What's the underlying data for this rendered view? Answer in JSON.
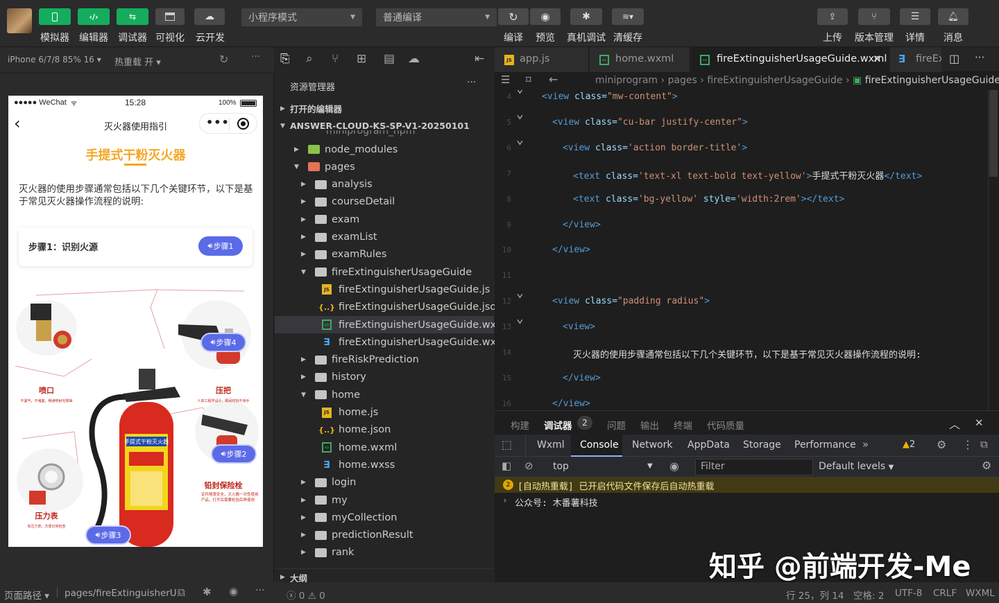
{
  "toolbar": {
    "left_buttons": [
      {
        "label": "模拟器",
        "icon": "phone-icon"
      },
      {
        "label": "编辑器",
        "icon": "code-icon"
      },
      {
        "label": "调试器",
        "icon": "debug-icon"
      },
      {
        "label": "可视化",
        "icon": "layout-icon"
      },
      {
        "label": "云开发",
        "icon": "cloud-icon"
      }
    ],
    "mode_select": "小程序模式",
    "compile_select": "普通编译",
    "mid_buttons": [
      "编译",
      "预览",
      "真机调试",
      "清缓存"
    ],
    "right_buttons": [
      "上传",
      "版本管理",
      "详情",
      "消息"
    ]
  },
  "simulator": {
    "device": "iPhone 6/7/8 85% 16",
    "hot_reload": "热重载 开",
    "status": {
      "carrier": "●●●●● WeChat",
      "time": "15:28",
      "battery": "100%"
    },
    "nav_title": "灭火器使用指引",
    "heading": "手提式干粉灭火器",
    "intro": "灭火器的使用步骤通常包括以下几个关键环节，以下是基于常见灭火器操作流程的说明:",
    "step_card_label": "步骤1：识别火源",
    "step_badges": [
      "步骤1",
      "步骤4",
      "步骤2",
      "步骤3"
    ],
    "image_labels": {
      "press_title": "压把",
      "press_desc": "人体工程学设计，瞬间时刻不滑手",
      "nozzle_title": "喷口",
      "nozzle_desc": "不漏气，不堵塞，畅通喷射无障碍",
      "seal_title": "铅封保险栓",
      "seal_desc": "证件随意安全，灭火器一次性使用产品，打开后需要检验后再使用",
      "gauge_title": "压力表",
      "gauge_desc": "有压力表，方便日常检查",
      "extinguisher_label": "手提式干粉灭火器"
    }
  },
  "explorer": {
    "toolbar_title": "资源管理器",
    "sections": [
      "打开的编辑器",
      "ANSWER-CLOUD-KS-SP-V1-20250101"
    ],
    "clipped_row": "miniprogram_npm",
    "tree": [
      {
        "label": "node_modules",
        "type": "folder-green",
        "depth": 1,
        "caret": "right"
      },
      {
        "label": "pages",
        "type": "folder-red",
        "depth": 1,
        "caret": "down"
      },
      {
        "label": "analysis",
        "type": "folder",
        "depth": 2,
        "caret": "right"
      },
      {
        "label": "courseDetail",
        "type": "folder",
        "depth": 2,
        "caret": "right"
      },
      {
        "label": "exam",
        "type": "folder",
        "depth": 2,
        "caret": "right"
      },
      {
        "label": "examList",
        "type": "folder",
        "depth": 2,
        "caret": "right"
      },
      {
        "label": "examRules",
        "type": "folder",
        "depth": 2,
        "caret": "right"
      },
      {
        "label": "fireExtinguisherUsageGuide",
        "type": "folder-open",
        "depth": 2,
        "caret": "down"
      },
      {
        "label": "fireExtinguisherUsageGuide.js",
        "type": "js",
        "depth": 3,
        "caret": ""
      },
      {
        "label": "fireExtinguisherUsageGuide.json",
        "type": "json",
        "depth": 3,
        "caret": ""
      },
      {
        "label": "fireExtinguisherUsageGuide.wxml",
        "type": "wxml",
        "depth": 3,
        "caret": "",
        "selected": true
      },
      {
        "label": "fireExtinguisherUsageGuide.wxss",
        "type": "wxss",
        "depth": 3,
        "caret": ""
      },
      {
        "label": "fireRiskPrediction",
        "type": "folder",
        "depth": 2,
        "caret": "right"
      },
      {
        "label": "history",
        "type": "folder",
        "depth": 2,
        "caret": "right"
      },
      {
        "label": "home",
        "type": "folder-open",
        "depth": 2,
        "caret": "down"
      },
      {
        "label": "home.js",
        "type": "js",
        "depth": 3,
        "caret": ""
      },
      {
        "label": "home.json",
        "type": "json",
        "depth": 3,
        "caret": ""
      },
      {
        "label": "home.wxml",
        "type": "wxml",
        "depth": 3,
        "caret": ""
      },
      {
        "label": "home.wxss",
        "type": "wxss",
        "depth": 3,
        "caret": ""
      },
      {
        "label": "login",
        "type": "folder",
        "depth": 2,
        "caret": "right"
      },
      {
        "label": "my",
        "type": "folder",
        "depth": 2,
        "caret": "right"
      },
      {
        "label": "myCollection",
        "type": "folder",
        "depth": 2,
        "caret": "right"
      },
      {
        "label": "predictionResult",
        "type": "folder",
        "depth": 2,
        "caret": "right"
      },
      {
        "label": "rank",
        "type": "folder",
        "depth": 2,
        "caret": "right"
      }
    ],
    "outline": "大纲"
  },
  "editor": {
    "tabs": [
      {
        "label": "app.js",
        "type": "js"
      },
      {
        "label": "home.wxml",
        "type": "wxml"
      },
      {
        "label": "fireExtinguisherUsageGuide.wxml",
        "type": "wxml",
        "active": true
      },
      {
        "label": "fireEx",
        "type": "wxss"
      }
    ],
    "breadcrumb": [
      "miniprogram",
      "pages",
      "fireExtinguisherUsageGuide",
      "fireExtinguisherUsageGuide.wxml"
    ],
    "lines": [
      {
        "n": "4",
        "indent": 0,
        "parts": [
          [
            "tag",
            "<view "
          ],
          [
            "attr",
            "class="
          ],
          [
            "str",
            "\"mw-content\""
          ],
          [
            "tag",
            ">"
          ]
        ]
      },
      {
        "n": "5",
        "indent": 1,
        "parts": [
          [
            "tag",
            "<view "
          ],
          [
            "attr",
            "class="
          ],
          [
            "str",
            "\"cu-bar justify-center\""
          ],
          [
            "tag",
            ">"
          ]
        ]
      },
      {
        "n": "6",
        "indent": 2,
        "parts": [
          [
            "tag",
            "<view "
          ],
          [
            "attr",
            "class="
          ],
          [
            "str",
            "'action border-title'"
          ],
          [
            "tag",
            ">"
          ]
        ]
      },
      {
        "n": "7",
        "indent": 3,
        "parts": [
          [
            "tag",
            "<text "
          ],
          [
            "attr",
            "class="
          ],
          [
            "str",
            "'text-xl text-bold text-yellow'"
          ],
          [
            "tag",
            ">"
          ],
          [
            "txt",
            "手提式干粉灭火器"
          ],
          [
            "tag",
            "</text>"
          ]
        ]
      },
      {
        "n": "8",
        "indent": 3,
        "parts": [
          [
            "tag",
            "<text "
          ],
          [
            "attr",
            "class="
          ],
          [
            "str",
            "'bg-yellow' "
          ],
          [
            "attr",
            "style="
          ],
          [
            "str",
            "'width:2rem'"
          ],
          [
            "tag",
            "></text>"
          ]
        ]
      },
      {
        "n": "9",
        "indent": 2,
        "parts": [
          [
            "tag",
            "</view>"
          ]
        ]
      },
      {
        "n": "10",
        "indent": 1,
        "parts": [
          [
            "tag",
            "</view>"
          ]
        ]
      },
      {
        "n": "11",
        "indent": 0,
        "parts": []
      },
      {
        "n": "12",
        "indent": 1,
        "parts": [
          [
            "tag",
            "<view "
          ],
          [
            "attr",
            "class="
          ],
          [
            "str",
            "\"padding radius\""
          ],
          [
            "tag",
            ">"
          ]
        ]
      },
      {
        "n": "13",
        "indent": 2,
        "parts": [
          [
            "tag",
            "<view>"
          ]
        ]
      },
      {
        "n": "14",
        "indent": 3,
        "parts": [
          [
            "txt",
            "灭火器的使用步骤通常包括以下几个关键环节，以下是基于常见灭火器操作流程的说明:"
          ]
        ]
      },
      {
        "n": "15",
        "indent": 2,
        "parts": [
          [
            "tag",
            "</view>"
          ]
        ]
      },
      {
        "n": "16",
        "indent": 1,
        "parts": [
          [
            "tag",
            "</view>"
          ]
        ]
      }
    ]
  },
  "panel": {
    "tabs": [
      "构建",
      "调试器",
      "问题",
      "输出",
      "终端",
      "代码质量"
    ],
    "debugger_badge": "2",
    "devtools_tabs": [
      "Wxml",
      "Console",
      "Network",
      "AppData",
      "Storage",
      "Performance"
    ],
    "warning_count": "2",
    "context": "top",
    "filter_placeholder": "Filter",
    "levels": "Default levels",
    "messages": [
      {
        "kind": "warning",
        "text": "[自动热重载] 已开启代码文件保存后自动热重载"
      },
      {
        "kind": "log",
        "text": "公众号: 木番薯科技"
      }
    ]
  },
  "watermark": "知乎 @前端开发-Me",
  "statusbar": {
    "page_path_label": "页面路径",
    "page_path": "pages/fireExtinguisherU...",
    "errors": "0",
    "warnings": "0",
    "position": "行 25，列 14",
    "spaces": "空格: 2",
    "encoding": "UTF-8",
    "eol": "CRLF",
    "language": "WXML"
  }
}
